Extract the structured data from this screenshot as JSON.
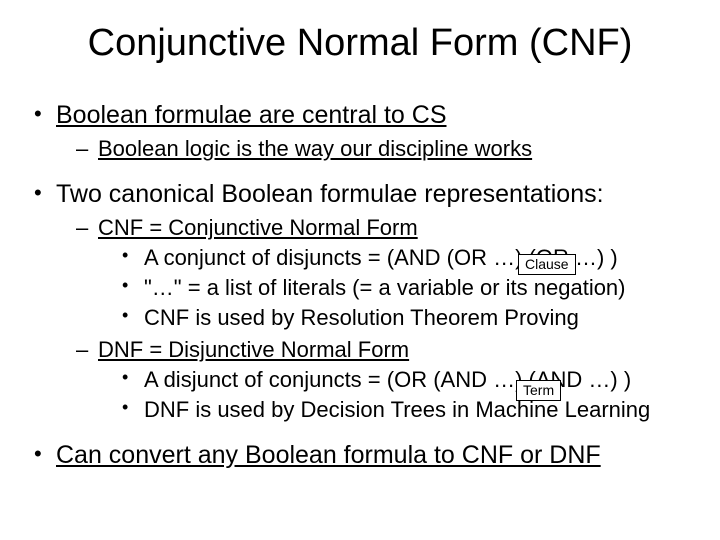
{
  "title": "Conjunctive Normal Form (CNF)",
  "b1": {
    "text": "Boolean formulae are central to CS",
    "sub1": "Boolean logic is the way our discipline works"
  },
  "b2": {
    "text": "Two canonical Boolean formulae representations:",
    "cnf": {
      "heading": "CNF = Conjunctive Normal Form",
      "p1": "A conjunct of disjuncts = (AND (OR …) (OR …) )",
      "p2": "\"…\" = a list of literals (= a variable or its negation)",
      "p3": "CNF is used by Resolution Theorem Proving"
    },
    "dnf": {
      "heading": "DNF = Disjunctive Normal Form",
      "p1": "A disjunct of conjuncts = (OR (AND …) (AND …) )",
      "p2": "DNF is used by Decision Trees in Machine Learning"
    }
  },
  "b3": {
    "text": "Can convert any Boolean formula to CNF or DNF"
  },
  "callouts": {
    "clause": "Clause",
    "term": "Term"
  }
}
